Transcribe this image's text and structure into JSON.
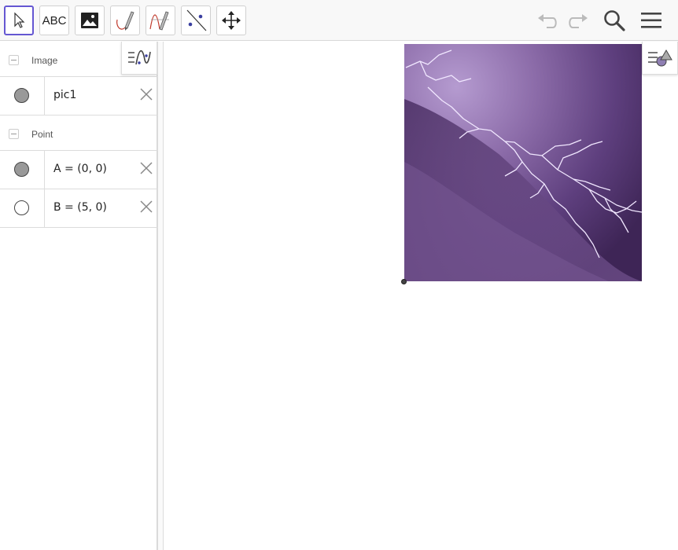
{
  "toolbar": {
    "tools": [
      {
        "name": "move-tool",
        "icon": "arrow-cursor-icon",
        "active": true
      },
      {
        "name": "text-tool",
        "label": "ABC"
      },
      {
        "name": "image-tool",
        "icon": "image-icon"
      },
      {
        "name": "pen-tool",
        "icon": "pen-icon"
      },
      {
        "name": "function-inspector-tool",
        "icon": "function-pen-icon"
      },
      {
        "name": "line-tool",
        "icon": "line-through-points-icon"
      },
      {
        "name": "move-graphics-tool",
        "icon": "move-arrows-icon"
      }
    ],
    "right": [
      "undo-icon",
      "redo-icon",
      "search-icon",
      "menu-icon"
    ]
  },
  "algebra": {
    "groups": [
      {
        "label": "Image",
        "items": [
          {
            "text": "pic1",
            "marker": "filled"
          }
        ]
      },
      {
        "label": "Point",
        "items": [
          {
            "text": "A = (0, 0)",
            "marker": "filled"
          },
          {
            "text": "B = (5, 0)",
            "marker": "empty"
          }
        ]
      }
    ]
  },
  "graphics": {
    "image_subject": "purple lightning storm"
  },
  "colors": {
    "accent": "#6557d2",
    "image_purple": "#6a4c8c"
  }
}
